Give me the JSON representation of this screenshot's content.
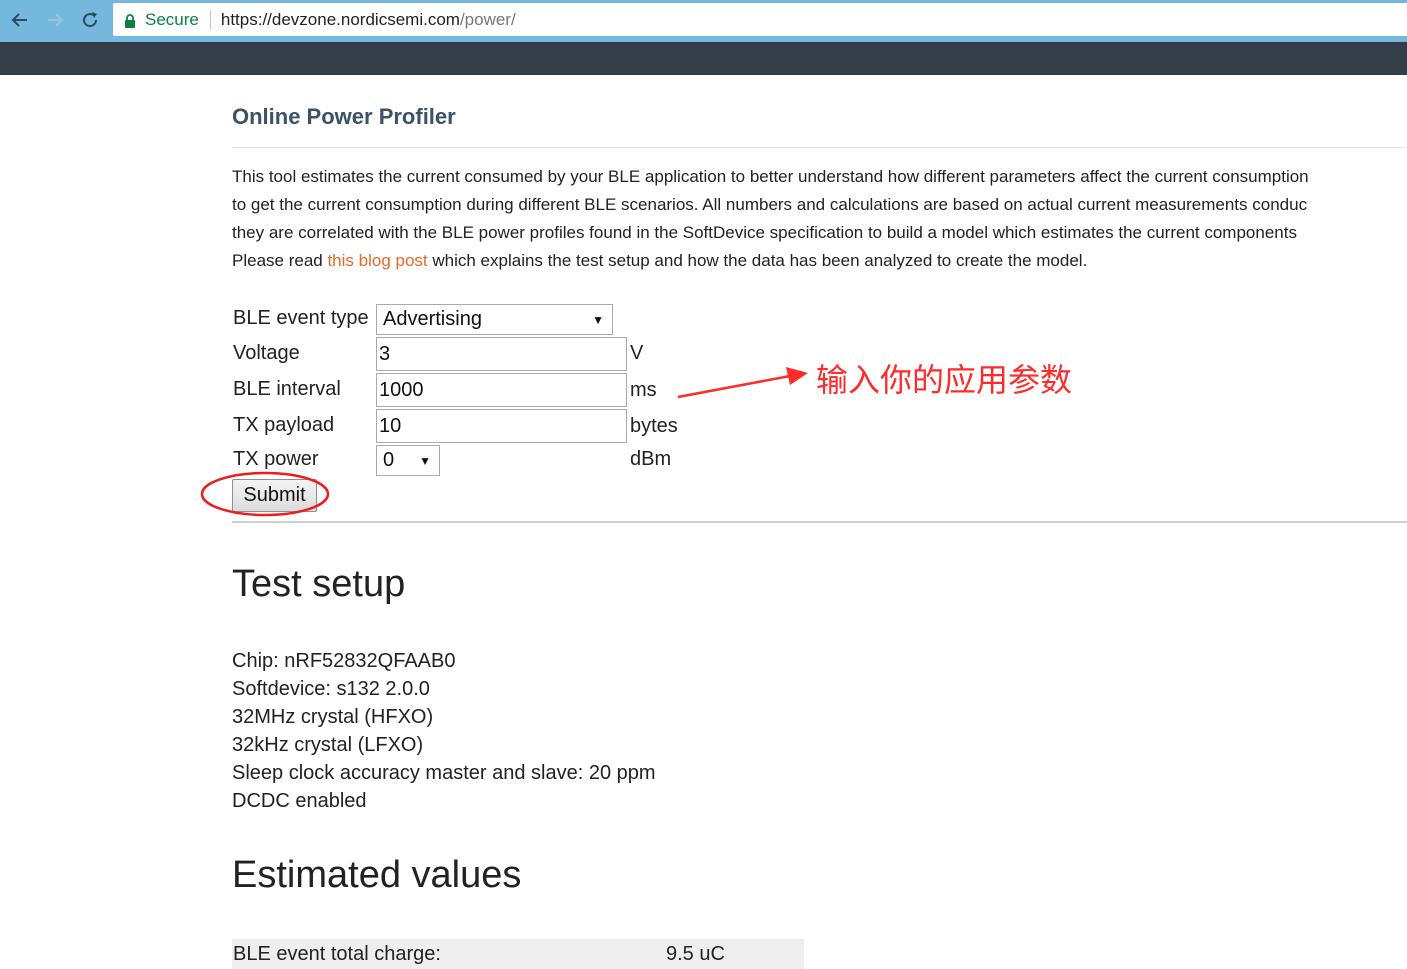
{
  "browser": {
    "secure_label": "Secure",
    "url_host": "https://devzone.nordicsemi.com",
    "url_path": "/power/",
    "colors": {
      "chrome": "#75b8dd",
      "site_bar": "#333e48",
      "secure": "#0b8043"
    }
  },
  "page": {
    "title": "Online Power Profiler",
    "intro_lines": [
      "This tool estimates the current consumed by your BLE application to better understand how different parameters affect the current consumption",
      "to get the current consumption during different BLE scenarios. All numbers and calculations are based on actual current measurements conduc",
      "they are correlated with the BLE power profiles found in the SoftDevice specification to build a model which estimates the current components"
    ],
    "intro_last_prefix": "Please read ",
    "intro_link": "this blog post",
    "intro_last_suffix": " which explains the test setup and how the data has been analyzed to create the model.",
    "link_color": "#e56a26"
  },
  "form": {
    "event_type": {
      "label": "BLE event type",
      "value": "Advertising"
    },
    "voltage": {
      "label": "Voltage",
      "value": "3",
      "unit": "V"
    },
    "interval": {
      "label": "BLE interval",
      "value": "1000",
      "unit": "ms"
    },
    "payload": {
      "label": "TX payload",
      "value": "10",
      "unit": "bytes"
    },
    "tx_power": {
      "label": "TX power",
      "value": "0",
      "unit": "dBm"
    },
    "submit_label": "Submit"
  },
  "test_setup": {
    "heading": "Test setup",
    "items": [
      "Chip: nRF52832QFAAB0",
      "Softdevice: s132 2.0.0",
      "32MHz crystal (HFXO)",
      "32kHz crystal (LFXO)",
      "Sleep clock accuracy master and slave: 20 ppm",
      "DCDC enabled"
    ]
  },
  "estimated": {
    "heading": "Estimated values",
    "rows": [
      {
        "label": "BLE event total charge:",
        "value": "9.5 uC"
      }
    ]
  },
  "annotation": {
    "text": "输入你的应用参数",
    "color": "#ff2a2a"
  }
}
